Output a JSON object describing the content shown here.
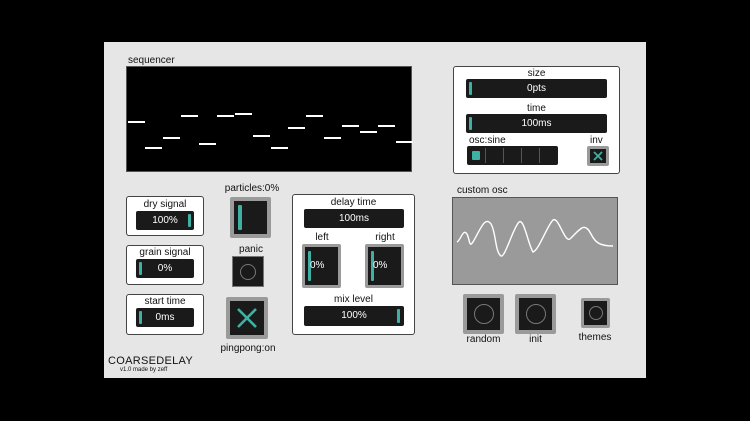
{
  "sequencer": {
    "label": "sequencer"
  },
  "size": {
    "label": "size",
    "value": "0pts"
  },
  "time": {
    "label": "time",
    "value": "100ms"
  },
  "osc": {
    "label": "osc:sine",
    "inv_label": "inv"
  },
  "dry": {
    "label": "dry signal",
    "value": "100%"
  },
  "grain": {
    "label": "grain signal",
    "value": "0%"
  },
  "start": {
    "label": "start time",
    "value": "0ms"
  },
  "particles": {
    "label": "particles:0%"
  },
  "panic": {
    "label": "panic"
  },
  "pingpong": {
    "label": "pingpong:on"
  },
  "delay": {
    "label": "delay time",
    "value": "100ms"
  },
  "left": {
    "label": "left",
    "value": "0%"
  },
  "right": {
    "label": "right",
    "value": "0%"
  },
  "mix": {
    "label": "mix level",
    "value": "100%"
  },
  "custom_osc": {
    "label": "custom osc"
  },
  "buttons": {
    "random": "random",
    "init": "init",
    "themes": "themes"
  },
  "brand": {
    "name": "COARSEDELAY",
    "byline": "v1.0 made by zeff"
  },
  "colors": {
    "accent": "#3fb0a3",
    "panel": "#e6e6e6",
    "field": "#1a1a1a"
  }
}
